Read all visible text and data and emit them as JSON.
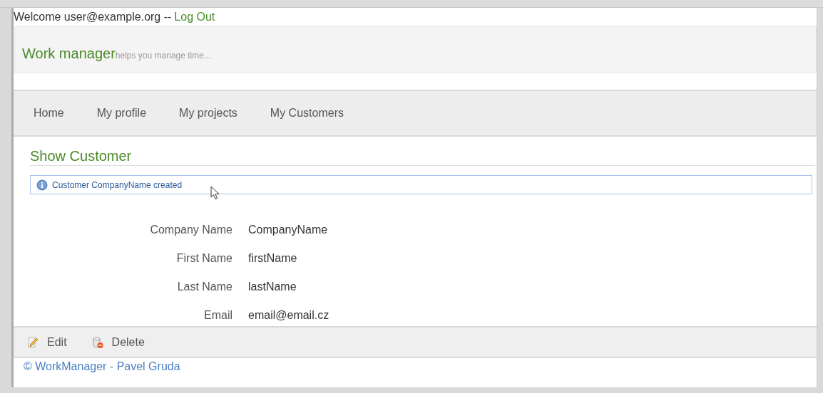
{
  "welcome": {
    "text": "Welcome user@example.org --",
    "logout": "Log Out"
  },
  "header": {
    "title": "Work manager",
    "tagline": "helps you manage time..."
  },
  "nav": [
    "Home",
    "My profile",
    "My projects",
    "My Customers"
  ],
  "page_title": "Show Customer",
  "message": "Customer CompanyName created",
  "fields": [
    {
      "label": "Company Name",
      "value": "CompanyName"
    },
    {
      "label": "First Name",
      "value": "firstName"
    },
    {
      "label": "Last Name",
      "value": "lastName"
    },
    {
      "label": "Email",
      "value": "email@email.cz"
    }
  ],
  "actions": [
    {
      "kind": "edit",
      "label": "Edit"
    },
    {
      "kind": "delete",
      "label": "Delete"
    }
  ],
  "footer": "© WorkManager - Pavel Gruda"
}
